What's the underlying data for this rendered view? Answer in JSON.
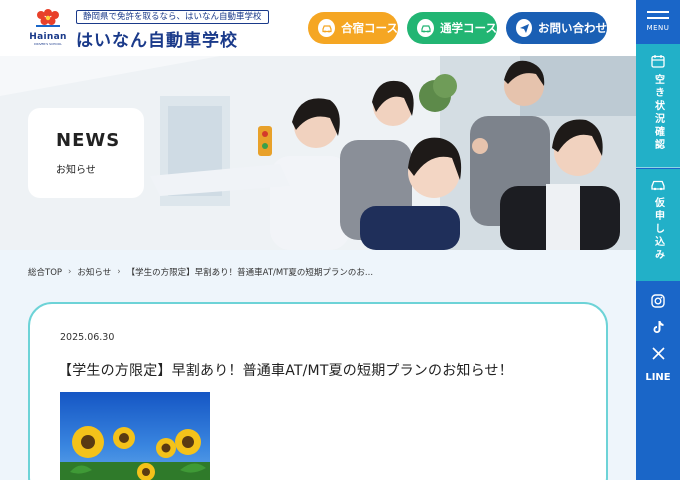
{
  "header": {
    "logo_word": "Hainan",
    "logo_sub": "DRIVER'S SCHOOL",
    "tagline": "静岡県で免許を取るなら、はいなん自動車学校",
    "school_name": "はいなん自動車学校",
    "buttons": [
      {
        "label": "合宿コース",
        "icon": "car-icon",
        "color": "#f5a623"
      },
      {
        "label": "通学コース",
        "icon": "car-icon",
        "color": "#22b573"
      },
      {
        "label": "お問い合わせ",
        "icon": "send-icon",
        "color": "#1a5fb4"
      }
    ]
  },
  "sidebar": {
    "menu_label": "MENU",
    "vacancy_label": "空き状況確認",
    "apply_label": "仮申し込み",
    "social": [
      "instagram-icon",
      "tiktok-icon",
      "x-icon"
    ],
    "line_label": "LINE"
  },
  "hero": {
    "news_title": "NEWS",
    "news_sub": "お知らせ"
  },
  "breadcrumb": [
    "総合TOP",
    "お知らせ",
    "【学生の方限定】早割あり！普通車AT/MT夏の短期プランのお..."
  ],
  "article": {
    "date": "2025.06.30",
    "title": "【学生の方限定】早割あり！普通車AT/MT夏の短期プランのお知らせ！"
  },
  "colors": {
    "brand_navy": "#1a3a8a",
    "sidebar_blue": "#1a66c8",
    "sidebar_teal": "#22b0c8",
    "card_border": "#6dd3d7"
  }
}
